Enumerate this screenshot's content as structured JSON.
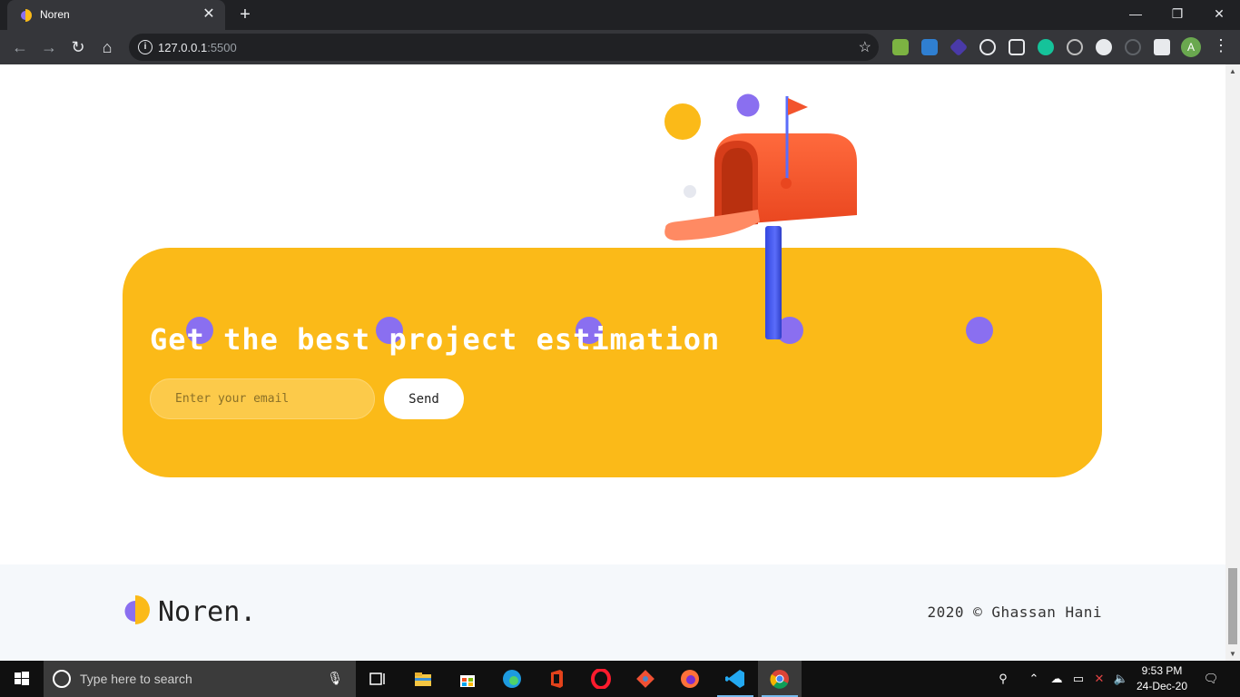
{
  "browser": {
    "tab_title": "Noren",
    "url_host": "127.0.0.1",
    "url_port": ":5500",
    "profile_initial": "A",
    "extensions": [
      "download-icon",
      "s-icon",
      "cube-icon",
      "react-icon",
      "diamond-icon",
      "grammarly-icon",
      "circle-target-icon",
      "record-icon",
      "recycle-icon",
      "puzzle-icon"
    ]
  },
  "cta": {
    "title": "Get the best project estimation",
    "email_placeholder": "Enter your email",
    "send_label": "Send"
  },
  "footer": {
    "brand": "Noren.",
    "copyright": "2020 © Ghassan Hani"
  },
  "taskbar": {
    "search_placeholder": "Type here to search",
    "time": "9:53 PM",
    "date": "24-Dec-20"
  },
  "colors": {
    "accent_yellow": "#fbba18",
    "accent_purple": "#8a6ff0",
    "mailbox_orange": "#f2542d",
    "post_blue": "#4a5cf5"
  }
}
